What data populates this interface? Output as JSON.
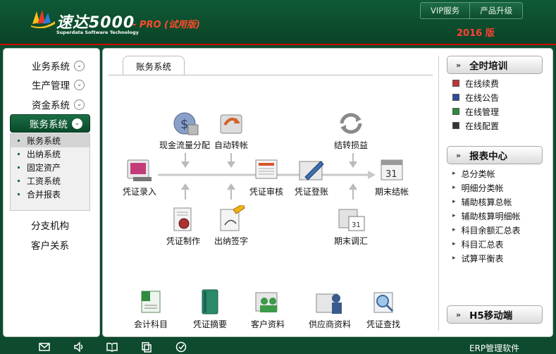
{
  "header": {
    "brand_name": "速达5000",
    "brand_sub": "Superdata Software Technology",
    "edition": "- PRO (试用版)",
    "year": "2016 版",
    "buttons": [
      "VIP服务",
      "产品升级"
    ]
  },
  "nav": {
    "items": [
      "业务系统",
      "生产管理",
      "资金系统"
    ],
    "active": "账务系统",
    "submenu": [
      "账务系统",
      "出纳系统",
      "固定资产",
      "工资系统",
      "合并报表"
    ],
    "lower_items": [
      "分支机构",
      "客户关系"
    ]
  },
  "main": {
    "tab_label": "账务系统",
    "flow": {
      "voucher_entry": "凭证录入",
      "cashflow_alloc": "现金流量分配",
      "auto_transfer": "自动转帐",
      "voucher_make": "凭证制作",
      "cashier_sign": "出纳签字",
      "voucher_audit": "凭证审核",
      "voucher_post": "凭证登账",
      "carry_forward": "结转损益",
      "period_adjust": "期末调汇",
      "period_close": "期末结帐"
    },
    "shortcuts": [
      "会计科目",
      "凭证摘要",
      "客户资料",
      "供应商资料",
      "凭证查找"
    ]
  },
  "right": {
    "training_title": "全时培训",
    "training_items": [
      "在线续费",
      "在线公告",
      "在线管理",
      "在线配置"
    ],
    "reports_title": "报表中心",
    "reports_items": [
      "总分类帐",
      "明细分类帐",
      "辅助核算总帐",
      "辅助核算明细帐",
      "科目余额汇总表",
      "科目汇总表",
      "试算平衡表"
    ],
    "mobile_title": "H5移动端"
  },
  "footer": {
    "label": "ERP管理软件"
  },
  "colors": {
    "brand_green": "#0d4a2e",
    "accent_red": "#ff4033"
  }
}
